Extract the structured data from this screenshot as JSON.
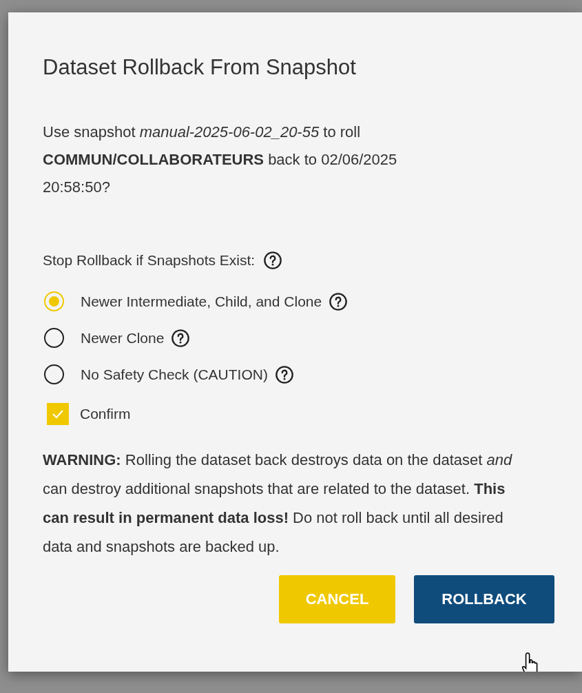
{
  "dialog": {
    "title": "Dataset Rollback From Snapshot",
    "message": "Use snapshot *manual-2025-06-02_20-55* to roll **COMMUN/COLLABORATEURS** back to 02/06/2025 20:58:50?",
    "stop_label": "Stop Rollback if Snapshots Exist:",
    "options": [
      {
        "label": "Newer Intermediate, Child, and Clone",
        "selected": true
      },
      {
        "label": "Newer Clone",
        "selected": false
      },
      {
        "label": "No Safety Check (CAUTION)",
        "selected": false
      }
    ],
    "confirm": {
      "label": "Confirm",
      "checked": true
    },
    "warning": "**WARNING:** Rolling the dataset back destroys data on the dataset *and* can destroy additional snapshots that are related to the dataset. **This can result in permanent data loss!** Do not roll back until all desired data and snapshots are backed up.",
    "buttons": [
      {
        "label": "CANCEL",
        "kind": "cancel"
      },
      {
        "label": "ROLLBACK",
        "kind": "primary"
      }
    ]
  }
}
